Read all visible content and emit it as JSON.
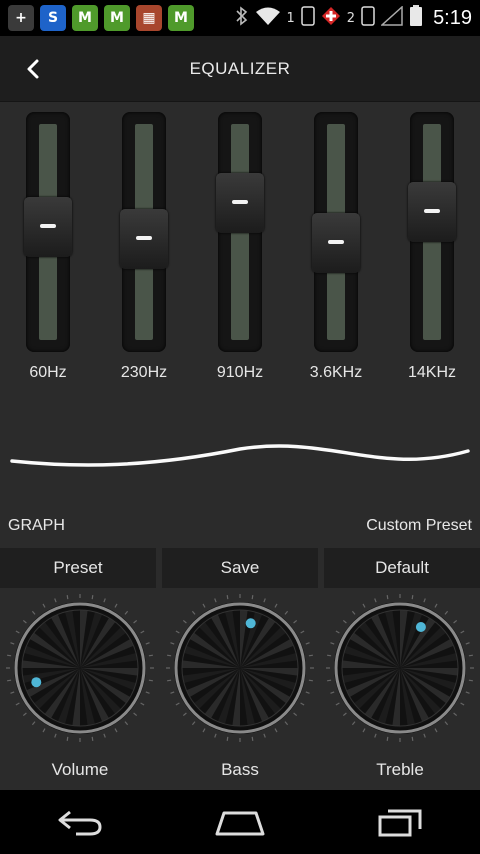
{
  "status_bar": {
    "apps": [
      {
        "icon": "plus-icon",
        "color": "#3a3a3a",
        "glyph": "+"
      },
      {
        "icon": "s-app-icon",
        "color": "#1e63c9",
        "glyph": "S"
      },
      {
        "icon": "green-app-icon",
        "color": "#4f9a2b",
        "glyph": "M"
      },
      {
        "icon": "green-app-icon-2",
        "color": "#4f9a2b",
        "glyph": "M"
      },
      {
        "icon": "multicolor-app-icon",
        "color": "#a8462d",
        "glyph": "▦"
      },
      {
        "icon": "green-app-icon-3",
        "color": "#4f9a2b",
        "glyph": "M"
      }
    ],
    "sim1": "1",
    "sim2": "2",
    "time": "5:19"
  },
  "topbar": {
    "title": "EQUALIZER"
  },
  "equalizer": {
    "bands": [
      {
        "label": "60Hz",
        "level": 0.53
      },
      {
        "label": "230Hz",
        "level": 0.46
      },
      {
        "label": "910Hz",
        "level": 0.66
      },
      {
        "label": "3.6KHz",
        "level": 0.44
      },
      {
        "label": "14KHz",
        "level": 0.61
      }
    ]
  },
  "graph": {
    "label": "GRAPH",
    "preset_name": "Custom Preset"
  },
  "buttons": {
    "preset": "Preset",
    "save": "Save",
    "default": "Default"
  },
  "knobs": [
    {
      "label": "Volume",
      "level": 0.1
    },
    {
      "label": "Bass",
      "level": 0.55
    },
    {
      "label": "Treble",
      "level": 0.6
    }
  ],
  "colors": {
    "accent": "#4fb6d6",
    "background": "#2b2b2b",
    "bar": "#1e1e1e"
  }
}
